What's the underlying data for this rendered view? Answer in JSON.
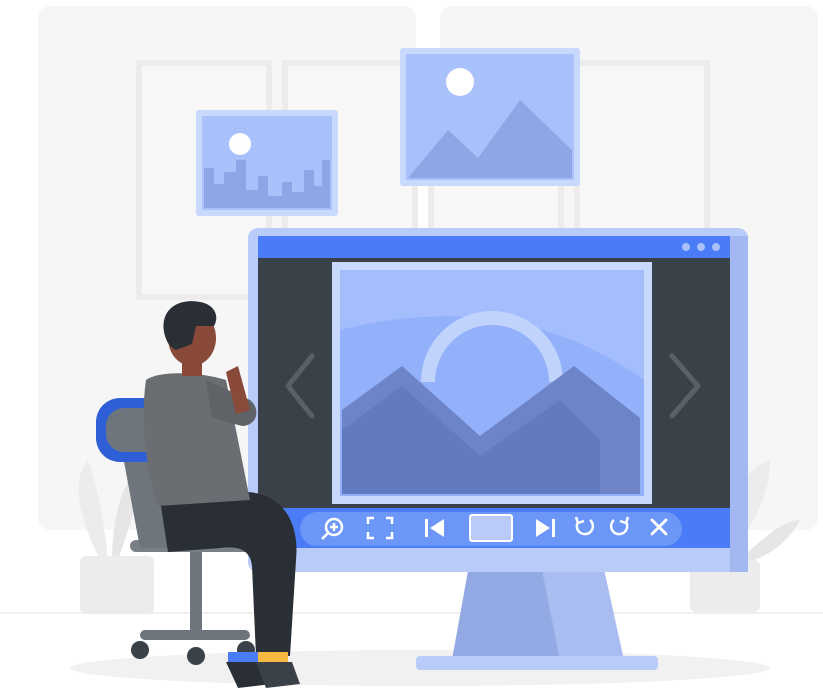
{
  "colors": {
    "accent": "#4a7cf7",
    "accent_light": "#a9c1fb",
    "accent_pale": "#c9d8fd",
    "screen_dark": "#3b4149",
    "frame": "#b9cbf9",
    "stand": "#a9bdf0",
    "wall": "#f4f4f4",
    "window_frame": "#e9e9e9",
    "shirt": "#6a6d72",
    "pants": "#2a2f36",
    "hair": "#2a2f36",
    "skin": "#8a4a3a",
    "chair_blue": "#2f5fd6",
    "chair_grey": "#6f757c"
  },
  "viewer": {
    "window_dots": [
      "dot-1",
      "dot-2",
      "dot-3"
    ],
    "nav": {
      "prev_icon": "chevron-left-icon",
      "next_icon": "chevron-right-icon"
    },
    "toolbar_icons": [
      "zoom-in-icon",
      "fullscreen-icon",
      "skip-previous-icon",
      "slideshow-frame-icon",
      "skip-next-icon",
      "rotate-left-icon",
      "rotate-right-icon",
      "close-icon"
    ]
  },
  "wall_pictures": [
    "landscape-picture",
    "city-skyline-picture"
  ]
}
